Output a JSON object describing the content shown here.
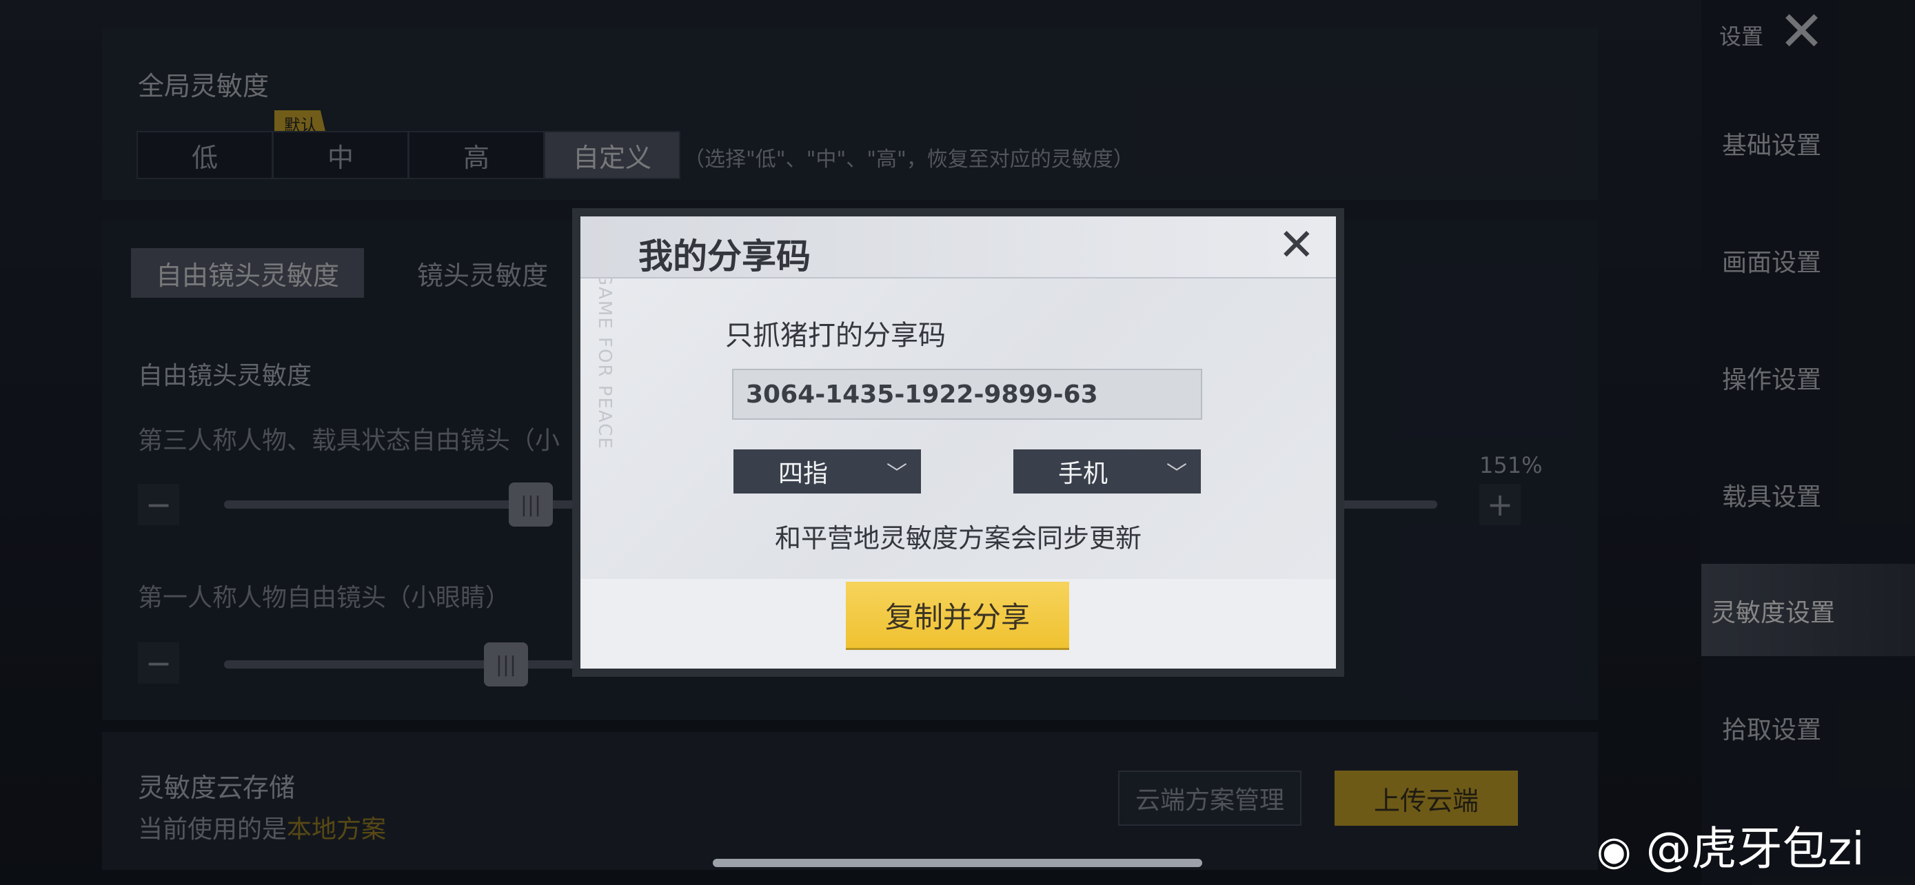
{
  "global": {
    "title": "全局灵敏度",
    "default_badge": "默认",
    "options": [
      "低",
      "中",
      "高",
      "自定义"
    ],
    "hint": "（选择\"低\"、\"中\"、\"高\"，恢复至对应的灵敏度）"
  },
  "tabs": [
    "自由镜头灵敏度",
    "镜头灵敏度"
  ],
  "free_camera": {
    "section_title": "自由镜头灵敏度",
    "row1_label": "第三人称人物、载具状态自由镜头（小",
    "row1_value": "151%",
    "row2_label": "第一人称人物自由镜头（小眼睛）"
  },
  "cloud": {
    "title": "灵敏度云存储",
    "current_prefix": "当前使用的是",
    "current_value": "本地方案",
    "manage_button": "云端方案管理",
    "upload_button": "上传云端"
  },
  "sidebar": {
    "title": "设置",
    "items": [
      "基础设置",
      "画面设置",
      "操作设置",
      "载具设置",
      "灵敏度设置",
      "拾取设置"
    ],
    "active_index": 4
  },
  "modal": {
    "title": "我的分享码",
    "owner_label": "只抓猪打的分享码",
    "share_code": "3064-1435-1922-9899-63",
    "finger_dropdown": "四指",
    "device_dropdown": "手机",
    "sync_note": "和平营地灵敏度方案会同步更新",
    "copy_button": "复制并分享",
    "watermark_text": "GAME FOR PEACE"
  },
  "weibo_watermark": "@虎牙包zi",
  "colors": {
    "accent_yellow": "#f0c231",
    "highlight_text": "#c9a227",
    "modal_bg": "#e6e8ec"
  }
}
